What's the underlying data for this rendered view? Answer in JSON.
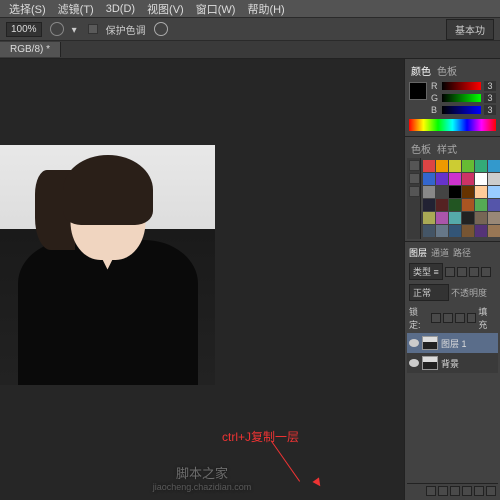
{
  "menu": {
    "items": [
      "选择(S)",
      "滤镜(T)",
      "3D(D)",
      "视图(V)",
      "窗口(W)",
      "帮助(H)"
    ]
  },
  "options": {
    "zoom": "100%",
    "protect": "保护色调",
    "essentials": "基本功"
  },
  "tab": {
    "name": "RGB/8) *"
  },
  "color_panel": {
    "tabs": [
      "颜色",
      "色板"
    ],
    "channels": [
      {
        "label": "R",
        "value": "3"
      },
      {
        "label": "G",
        "value": "3"
      },
      {
        "label": "B",
        "value": "3"
      }
    ]
  },
  "swatches_panel": {
    "tabs": [
      "色板",
      "样式"
    ]
  },
  "swatch_colors": [
    "#d44",
    "#e90",
    "#cc3",
    "#6b3",
    "#3a7",
    "#39c",
    "#36c",
    "#63c",
    "#c3c",
    "#c36",
    "#fff",
    "#ccc",
    "#888",
    "#444",
    "#000",
    "#630",
    "#fc9",
    "#9cf",
    "#223",
    "#522",
    "#252",
    "#a52",
    "#5a5",
    "#55a",
    "#aa5",
    "#a5a",
    "#5aa",
    "#222",
    "#765",
    "#987",
    "#456",
    "#678",
    "#357",
    "#753",
    "#537",
    "#975"
  ],
  "layers_panel": {
    "tabs": [
      "图层",
      "通道",
      "路径"
    ],
    "filter": "类型 ≡",
    "blend": "正常",
    "opacity_label": "不透明度",
    "lock_label": "锁定:",
    "fill_label": "填充",
    "layers": [
      {
        "name": "图层 1",
        "active": true
      },
      {
        "name": "背景",
        "active": false
      }
    ]
  },
  "annotation": {
    "text": "ctrl+J复制一层"
  },
  "watermark": {
    "main": "脚本之家",
    "sub": "jiaocheng.chazidian.com"
  }
}
